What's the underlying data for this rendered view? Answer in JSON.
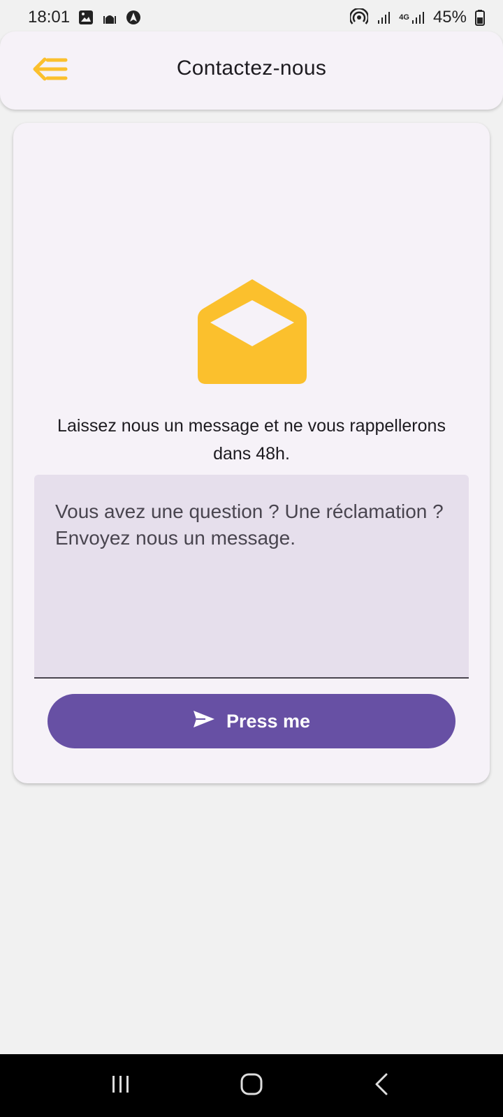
{
  "status_bar": {
    "time": "18:01",
    "battery": "45%",
    "network": "4G",
    "icons": [
      "gallery-icon",
      "mosque-icon",
      "navigation-icon",
      "hotspot-icon",
      "signal-icon",
      "signal-4g-icon",
      "battery-icon"
    ]
  },
  "app_bar": {
    "title": "Contactez-nous",
    "menu_icon": "menu-back-icon"
  },
  "colors": {
    "accent": "#FBC02D",
    "primary": "#6750A4",
    "field_bg": "#E6DFEC",
    "surface": "#F6F2F8"
  },
  "contact": {
    "icon": "envelope-open-icon",
    "intro": "Laissez nous un message et ne vous rappellerons dans 48h.",
    "message_placeholder": "Vous avez une question ? Une réclamation ? Envoyez nous un message.",
    "submit_label": "Press me",
    "submit_icon": "send-icon"
  },
  "navigation": {
    "buttons": [
      "recents-icon",
      "home-icon",
      "back-icon"
    ]
  }
}
